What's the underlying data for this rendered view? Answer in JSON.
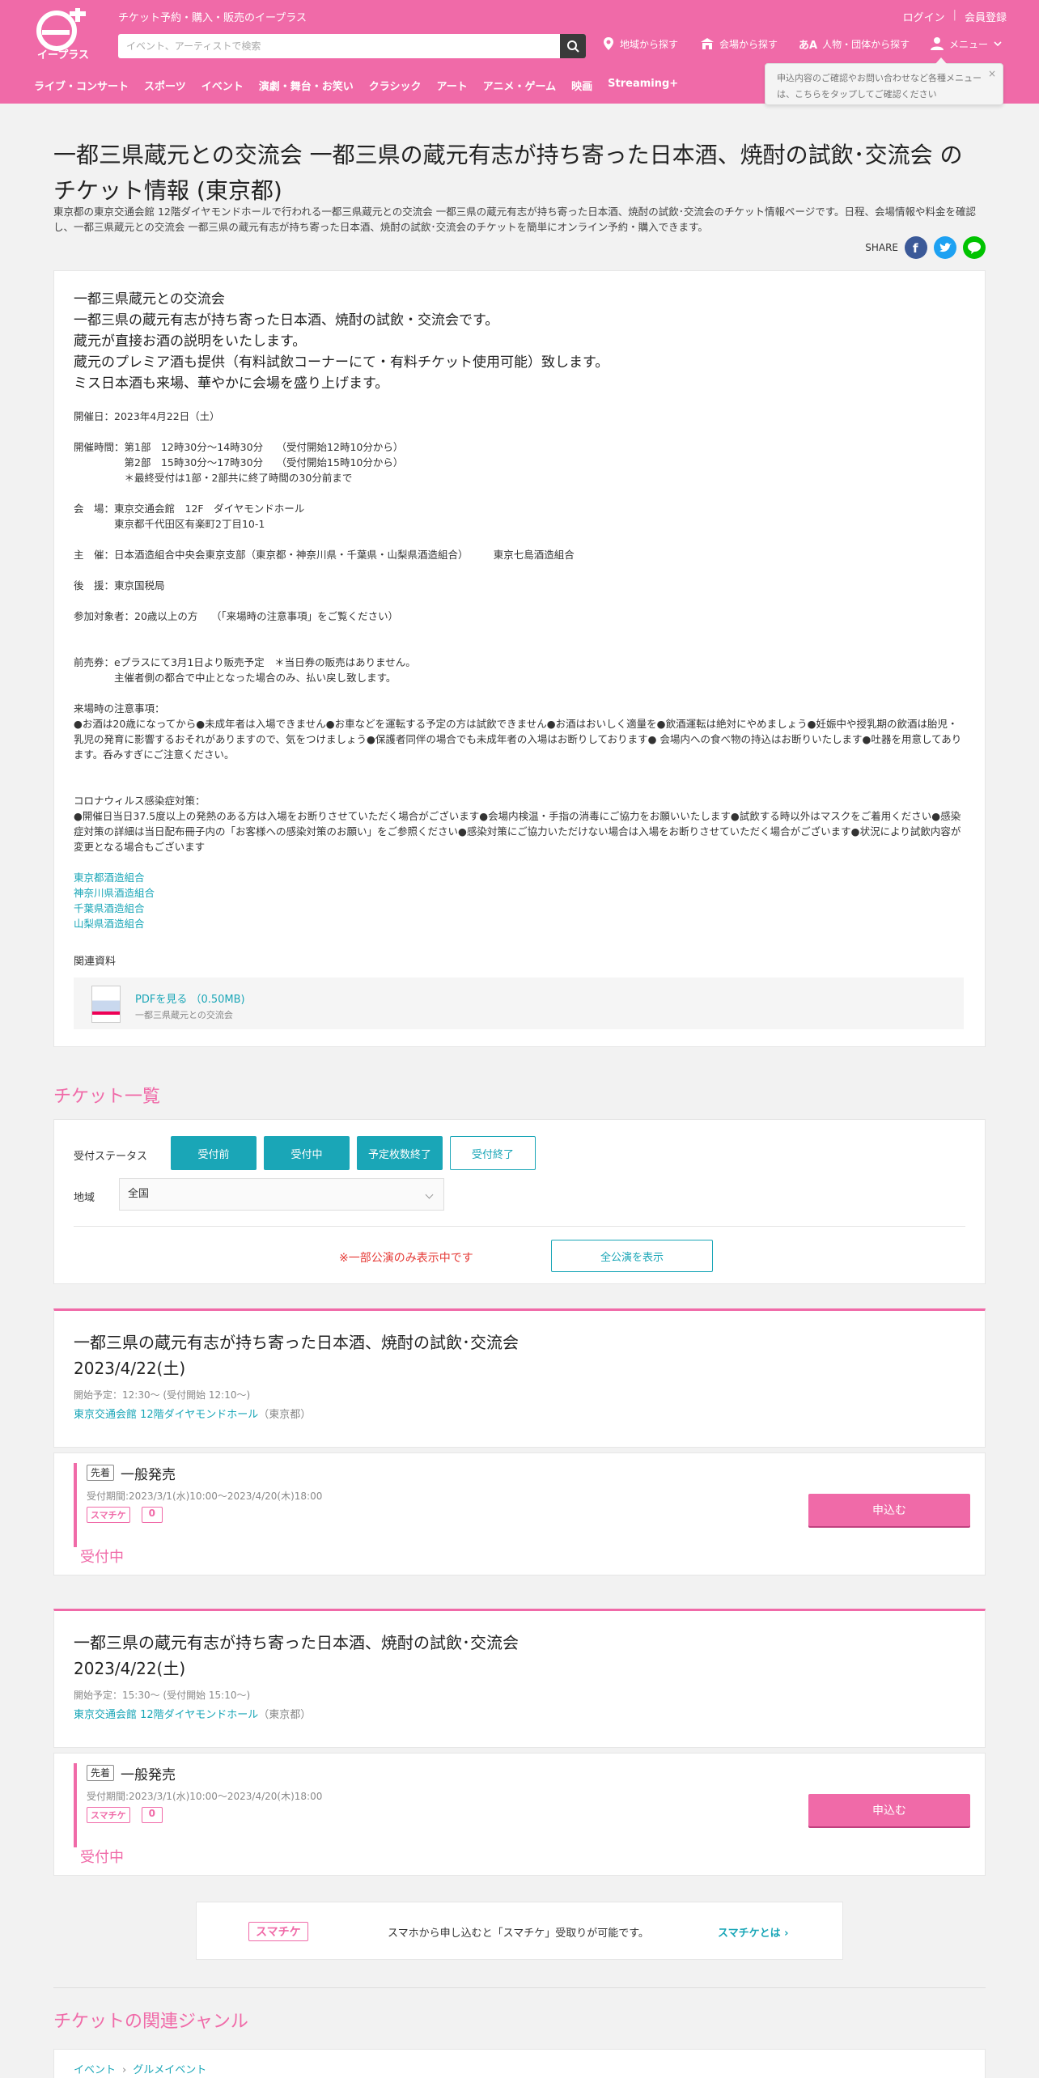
{
  "header": {
    "tagline": "チケット予約・購入・販売のイープラス",
    "login": "ログイン",
    "register": "会員登録",
    "search_placeholder": "イベント、アーティストで検索",
    "nav": {
      "area": "地域から探す",
      "venue": "会場から探す",
      "person": "人物・団体から探す",
      "menu": "メニュー"
    },
    "categories": [
      "ライブ・コンサート",
      "スポーツ",
      "イベント",
      "演劇・舞台・お笑い",
      "クラシック",
      "アート",
      "アニメ・ゲーム",
      "映画",
      "Streaming+"
    ],
    "tooltip": "申込内容のご確認やお問い合わせなど各種メニューは、こちらをタップしてご確認ください",
    "person_badge": "あA"
  },
  "page": {
    "title": "一都三県蔵元との交流会 一都三県の蔵元有志が持ち寄った日本酒、焼酎の試飲･交流会 のチケット情報 (東京都)",
    "lead": "東京都の東京交通会館 12階ダイヤモンドホールで行われる一都三県蔵元との交流会 一都三県の蔵元有志が持ち寄った日本酒、焼酎の試飲･交流会のチケット情報ページです。日程、会場情報や料金を確認し、一都三県蔵元との交流会 一都三県の蔵元有志が持ち寄った日本酒、焼酎の試飲･交流会のチケットを簡単にオンライン予約・購入できます。",
    "share": "SHARE"
  },
  "desc": {
    "headline": [
      "一都三県蔵元との交流会",
      "一都三県の蔵元有志が持ち寄った日本酒、焼酎の試飲・交流会です。",
      "蔵元が直接お酒の説明をいたします。",
      "蔵元のプレミア酒も提供（有料試飲コーナーにて・有料チケット使用可能）致します。",
      "ミス日本酒も来場、華やかに会場を盛り上げます。"
    ],
    "date": "開催日：2023年4月22日（土）",
    "time": "開催時間：第1部　12時30分～14時30分　 （受付開始12時10分から）\n　　　　　第2部　15時30分～17時30分　 （受付開始15時10分から）\n　　　　　＊最終受付は1部・2部共に終了時間の30分前まで",
    "venue": "会　場：東京交通会館　12F　ダイヤモンドホール\n　　　　東京都千代田区有楽町2丁目10-1",
    "organizer": "主　催：日本酒造組合中央会東京支部（東京都・神奈川県・千葉県・山梨県酒造組合）　　　東京七島酒造組合",
    "support": "後　援：東京国税局",
    "target": "参加対象者：20歳以上の方　 （「来場時の注意事項」をご覧ください）",
    "presale": "前売券：eプラスにて3月1日より販売予定　＊当日券の販売はありません。\n　　　　主催者側の都合で中止となった場合のみ、払い戻し致します。",
    "caution": "来場時の注意事項：\n●お酒は20歳になってから●未成年者は入場できません●お車などを運転する予定の方は試飲できません●お酒はおいしく適量を●飲酒運転は絶対にやめましょう●妊娠中や授乳期の飲酒は胎児・乳児の発育に影響するおそれがありますので、気をつけましょう●保護者同伴の場合でも未成年者の入場はお断りしております● 会場内への食べ物の持込はお断りいたします●吐器を用意してあります。呑みすぎにご注意ください。",
    "covid": "コロナウィルス感染症対策：\n●開催日当日37.5度以上の発熱のある方は入場をお断りさせていただく場合がございます●会場内検温・手指の消毒にご協力をお願いいたします●試飲する時以外はマスクをご着用ください●感染症対策の詳細は当日配布冊子内の「お客様への感染対策のお願い」をご参照ください●感染対策にご協力いただけない場合は入場をお断りさせていただく場合がございます●状況により試飲内容が変更となる場合もございます",
    "links": [
      "東京都酒造組合",
      "神奈川県酒造組合",
      "千葉県酒造組合",
      "山梨県酒造組合"
    ],
    "related_label": "関連資料",
    "pdf_label": "PDFを見る （0.50MB)",
    "pdf_sub": "一都三県蔵元との交流会"
  },
  "tickets": {
    "heading": "チケット一覧",
    "status_label": "受付ステータス",
    "statuses": [
      "受付前",
      "受付中",
      "予定枚数終了",
      "受付終了"
    ],
    "area_label": "地域",
    "area_value": "全国",
    "note": "※一部公演のみ表示中です",
    "all_button": "全公演を表示"
  },
  "performances": [
    {
      "title": "一都三県の蔵元有志が持ち寄った日本酒、焼酎の試飲･交流会",
      "date": "2023/4/22(土)",
      "start": "開始予定：12:30～ (受付開始 12:10～)",
      "venue": "東京交通会館 12階ダイヤモンドホール",
      "pref": "（東京都）",
      "badge": "先着",
      "type": "一般発売",
      "period": "受付期間:2023/3/1(水)10:00～2023/4/20(木)18:00",
      "logo1": "スマチケ",
      "logo2": "0",
      "apply": "申込む",
      "status": "受付中"
    },
    {
      "title": "一都三県の蔵元有志が持ち寄った日本酒、焼酎の試飲･交流会",
      "date": "2023/4/22(土)",
      "start": "開始予定：15:30～ (受付開始 15:10～)",
      "venue": "東京交通会館 12階ダイヤモンドホール",
      "pref": "（東京都）",
      "badge": "先着",
      "type": "一般発売",
      "period": "受付期間:2023/3/1(水)10:00～2023/4/20(木)18:00",
      "logo1": "スマチケ",
      "logo2": "0",
      "apply": "申込む",
      "status": "受付中"
    }
  ],
  "sumachi": {
    "logo": "スマチケ",
    "text": "スマホから申し込むと「スマチケ」受取りが可能です。",
    "link": "スマチケとは"
  },
  "genre": {
    "heading": "チケットの関連ジャンル",
    "crumbs": [
      "イベント",
      "グルメイベント"
    ]
  }
}
